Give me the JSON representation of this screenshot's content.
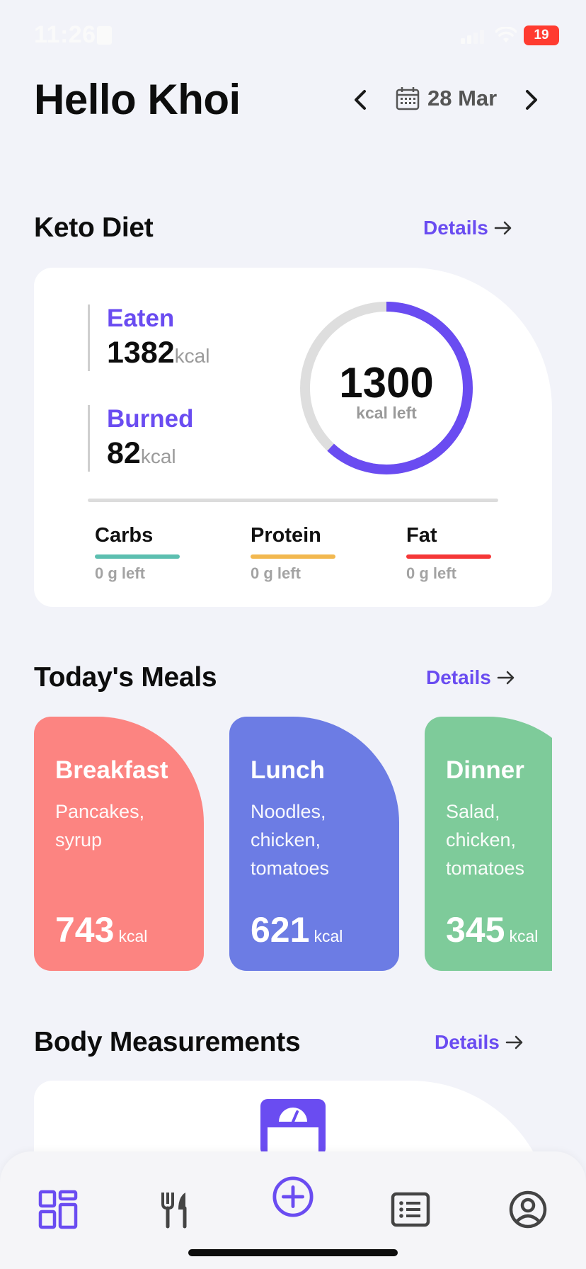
{
  "status": {
    "time": "11:26",
    "battery": "19"
  },
  "header": {
    "greeting": "Hello Khoi",
    "date": "28 Mar"
  },
  "colors": {
    "accent": "#6a4cf1",
    "carbs": "#5cbfb0",
    "protein": "#f2b84f",
    "fat": "#f53737",
    "breakfast": "#fc8481",
    "lunch": "#6c7ce4",
    "dinner": "#7ecb9a"
  },
  "diet": {
    "title": "Keto Diet",
    "details_label": "Details",
    "eaten_label": "Eaten",
    "eaten_value": "1382",
    "burned_label": "Burned",
    "burned_value": "82",
    "unit": "kcal",
    "remaining_value": "1300",
    "remaining_label": "kcal left",
    "ring_progress": 0.62,
    "macros": [
      {
        "name": "Carbs",
        "left": "0 g left"
      },
      {
        "name": "Protein",
        "left": "0 g left"
      },
      {
        "name": "Fat",
        "left": "0 g left"
      }
    ]
  },
  "meals": {
    "title": "Today's Meals",
    "details_label": "Details",
    "items": [
      {
        "name": "Breakfast",
        "desc1": "Pancakes,",
        "desc2": "syrup",
        "desc3": "",
        "kcal": "743",
        "unit": "kcal"
      },
      {
        "name": "Lunch",
        "desc1": "Noodles,",
        "desc2": "chicken,",
        "desc3": "tomatoes",
        "kcal": "621",
        "unit": "kcal"
      },
      {
        "name": "Dinner",
        "desc1": "Salad,",
        "desc2": "chicken,",
        "desc3": "tomatoes",
        "kcal": "345",
        "unit": "kcal"
      }
    ]
  },
  "body": {
    "title": "Body Measurements",
    "details_label": "Details"
  },
  "tabs": [
    {
      "icon": "dashboard-icon"
    },
    {
      "icon": "meals-icon"
    },
    {
      "icon": "add-icon"
    },
    {
      "icon": "list-icon"
    },
    {
      "icon": "profile-icon"
    }
  ]
}
